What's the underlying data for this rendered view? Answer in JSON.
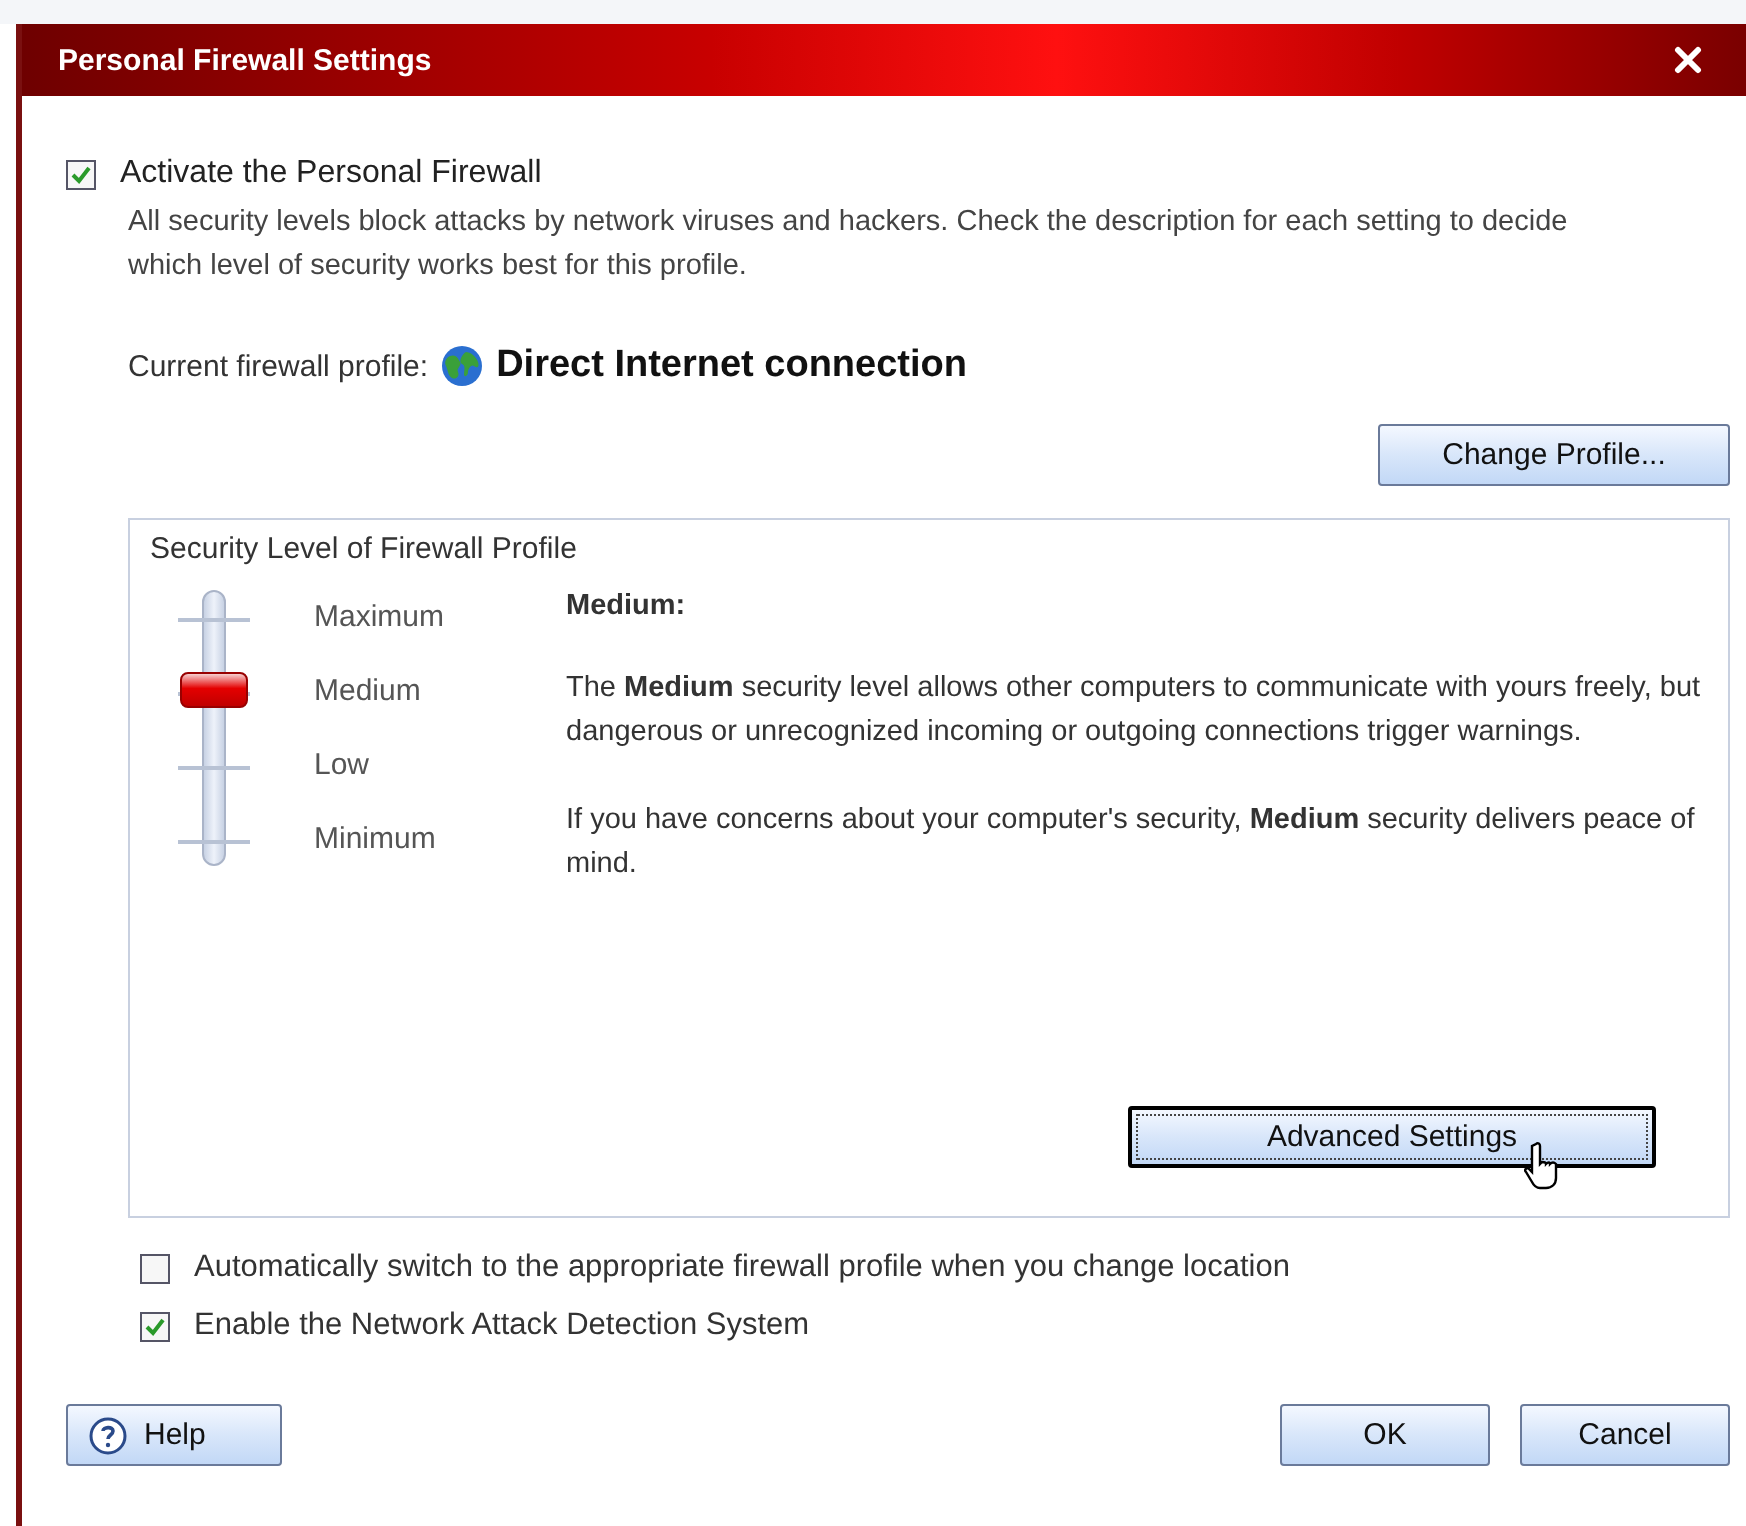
{
  "window": {
    "title": "Personal Firewall Settings"
  },
  "activate": {
    "label": "Activate the Personal Firewall",
    "checked": true,
    "description": "All security levels block attacks by network viruses and hackers. Check the description for each setting to decide which level of security works best for this profile."
  },
  "profile": {
    "label": "Current firewall profile:",
    "name": "Direct Internet connection",
    "button": "Change Profile..."
  },
  "security": {
    "title": "Security Level of Firewall Profile",
    "levels": [
      "Maximum",
      "Medium",
      "Low",
      "Minimum"
    ],
    "slider": {
      "level": 0.667
    },
    "heading": "Medium:",
    "paragraphs": [
      "The **Medium** security level allows other computers to communicate with yours freely, but dangerous or unrecognized incoming or outgoing connections trigger warnings.",
      "If you have concerns about your computer's security, **Medium** security delivers peace of mind."
    ],
    "button": "Advanced Settings"
  },
  "options": [
    {
      "label": "Automatically switch to the appropriate firewall profile when you change location",
      "checked": false
    },
    {
      "label": "Enable the Network Attack Detection System",
      "checked": true
    }
  ],
  "buttons": {
    "help": "Help",
    "ok": "OK",
    "cancel": "Cancel"
  }
}
